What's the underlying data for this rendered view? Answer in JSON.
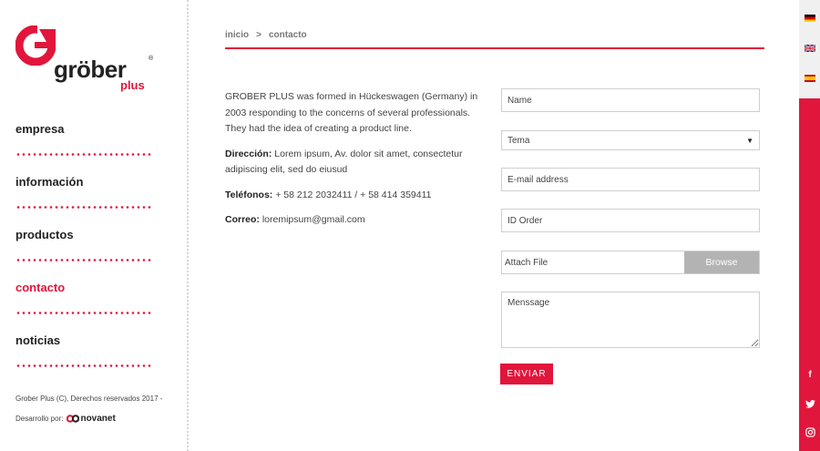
{
  "brand": {
    "name": "gröber",
    "sub": "plus",
    "reg": "®",
    "accent_color": "#e1163c"
  },
  "nav": {
    "items": [
      {
        "label": "empresa",
        "active": false
      },
      {
        "label": "información",
        "active": false
      },
      {
        "label": "productos",
        "active": false
      },
      {
        "label": "contacto",
        "active": true
      },
      {
        "label": "noticias",
        "active": false
      }
    ]
  },
  "footer": {
    "copyright": "Grober Plus (C), Derechos reservados 2017 -",
    "developed_by": "Desarrollo por:",
    "dev_brand": "novanet"
  },
  "breadcrumb": {
    "home": "inicio",
    "separator": ">",
    "current": "contacto"
  },
  "info": {
    "about": "GROBER PLUS was formed in Hückeswagen (Germany) in 2003 responding to the concerns of several professionals. They had the idea of creating a product line.",
    "address_label": "Dirección:",
    "address": "Lorem ipsum, Av. dolor sit amet, consectetur adipiscing elit, sed do eiusud",
    "phones_label": "Teléfonos:",
    "phones": "+ 58 212 2032411 / + 58 414 359411",
    "email_label": "Correo:",
    "email": "loremipsum@gmail.com"
  },
  "form": {
    "name_placeholder": "Name",
    "topic_selected": "Tema",
    "email_placeholder": "E-mail address",
    "order_placeholder": "ID Order",
    "attach_placeholder": "Attach File",
    "browse_label": "Browse",
    "message_placeholder": "Menssage",
    "submit_label": "ENVIAR"
  },
  "languages": [
    "de-flag-icon",
    "en-flag-icon",
    "es-flag-icon"
  ],
  "social": [
    "facebook-icon",
    "twitter-icon",
    "instagram-icon"
  ]
}
